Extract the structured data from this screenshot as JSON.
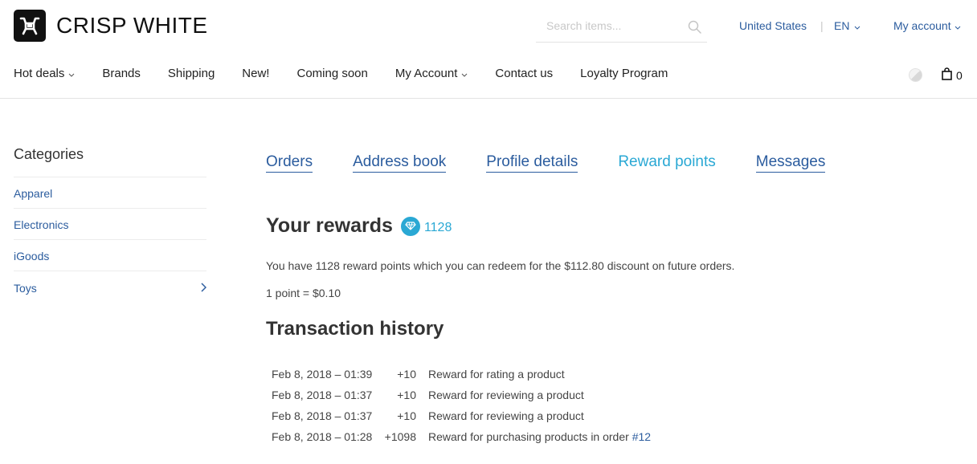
{
  "brand": {
    "name": "CRISP WHITE",
    "logo_icon": "shop-logo-icon"
  },
  "search": {
    "placeholder": "Search items...",
    "icon": "search-icon"
  },
  "top_links": {
    "country": "United States",
    "language": "EN",
    "account": "My account"
  },
  "nav": [
    {
      "label": "Hot deals",
      "has_dropdown": true
    },
    {
      "label": "Brands",
      "has_dropdown": false
    },
    {
      "label": "Shipping",
      "has_dropdown": false
    },
    {
      "label": "New!",
      "has_dropdown": false
    },
    {
      "label": "Coming soon",
      "has_dropdown": false
    },
    {
      "label": "My Account",
      "has_dropdown": true
    },
    {
      "label": "Contact us",
      "has_dropdown": false
    },
    {
      "label": "Loyalty Program",
      "has_dropdown": false
    }
  ],
  "cart": {
    "count": "0",
    "icon": "shopping-bag-icon"
  },
  "sidebar": {
    "title": "Categories",
    "items": [
      {
        "label": "Apparel",
        "has_children": false
      },
      {
        "label": "Electronics",
        "has_children": false
      },
      {
        "label": "iGoods",
        "has_children": false
      },
      {
        "label": "Toys",
        "has_children": true
      }
    ]
  },
  "account_tabs": [
    {
      "label": "Orders",
      "active": false
    },
    {
      "label": "Address book",
      "active": false
    },
    {
      "label": "Profile details",
      "active": false
    },
    {
      "label": "Reward points",
      "active": true
    },
    {
      "label": "Messages",
      "active": false
    }
  ],
  "rewards": {
    "title": "Your rewards",
    "points": "1128",
    "summary": "You have 1128 reward points which you can redeem for the $112.80 discount on future orders.",
    "rate": "1 point = $0.10"
  },
  "history": {
    "title": "Transaction history",
    "rows": [
      {
        "date": "Feb 8, 2018 – 01:39",
        "points": "+10",
        "description": "Reward for rating a product",
        "link": ""
      },
      {
        "date": "Feb 8, 2018 – 01:37",
        "points": "+10",
        "description": "Reward for reviewing a product",
        "link": ""
      },
      {
        "date": "Feb 8, 2018 – 01:37",
        "points": "+10",
        "description": "Reward for reviewing a product",
        "link": ""
      },
      {
        "date": "Feb 8, 2018 – 01:28",
        "points": "+1098",
        "description": "Reward for purchasing products in order ",
        "link": "#12"
      }
    ]
  },
  "colors": {
    "link": "#2b5c9e",
    "accent": "#2aa8d4",
    "text": "#333333"
  }
}
